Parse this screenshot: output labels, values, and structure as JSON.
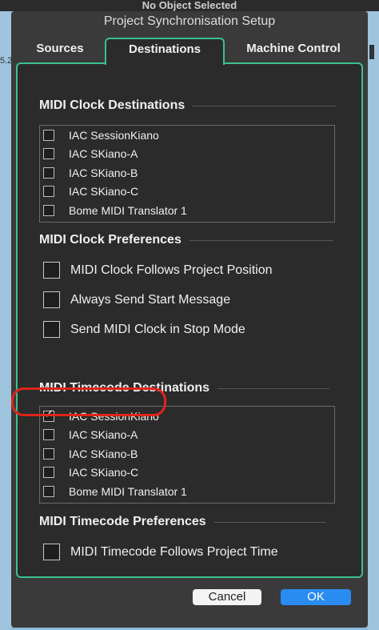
{
  "background": {
    "top_text": "No Object Selected",
    "left_number": "5.2"
  },
  "dialog": {
    "title": "Project Synchronisation Setup",
    "tabs": {
      "sources": "Sources",
      "destinations": "Destinations",
      "machine_control": "Machine Control"
    },
    "midi_clock_destinations": {
      "title": "MIDI Clock Destinations",
      "items": [
        {
          "label": "IAC SessionKiano",
          "checked": false
        },
        {
          "label": "IAC SKiano-A",
          "checked": false
        },
        {
          "label": "IAC SKiano-B",
          "checked": false
        },
        {
          "label": "IAC SKiano-C",
          "checked": false
        },
        {
          "label": "Bome MIDI Translator 1",
          "checked": false
        }
      ]
    },
    "midi_clock_preferences": {
      "title": "MIDI Clock Preferences",
      "options": [
        {
          "label": "MIDI Clock Follows Project Position",
          "checked": false
        },
        {
          "label": "Always Send Start Message",
          "checked": false
        },
        {
          "label": "Send MIDI Clock in Stop Mode",
          "checked": false
        }
      ]
    },
    "midi_timecode_destinations": {
      "title": "MIDI Timecode Destinations",
      "items": [
        {
          "label": "IAC SessionKiano",
          "checked": true
        },
        {
          "label": "IAC SKiano-A",
          "checked": false
        },
        {
          "label": "IAC SKiano-B",
          "checked": false
        },
        {
          "label": "IAC SKiano-C",
          "checked": false
        },
        {
          "label": "Bome MIDI Translator 1",
          "checked": false
        }
      ]
    },
    "midi_timecode_preferences": {
      "title": "MIDI Timecode Preferences",
      "options": [
        {
          "label": "MIDI Timecode Follows Project Time",
          "checked": false
        }
      ]
    },
    "buttons": {
      "cancel": "Cancel",
      "ok": "OK"
    },
    "checkmark_glyph": "✓"
  }
}
